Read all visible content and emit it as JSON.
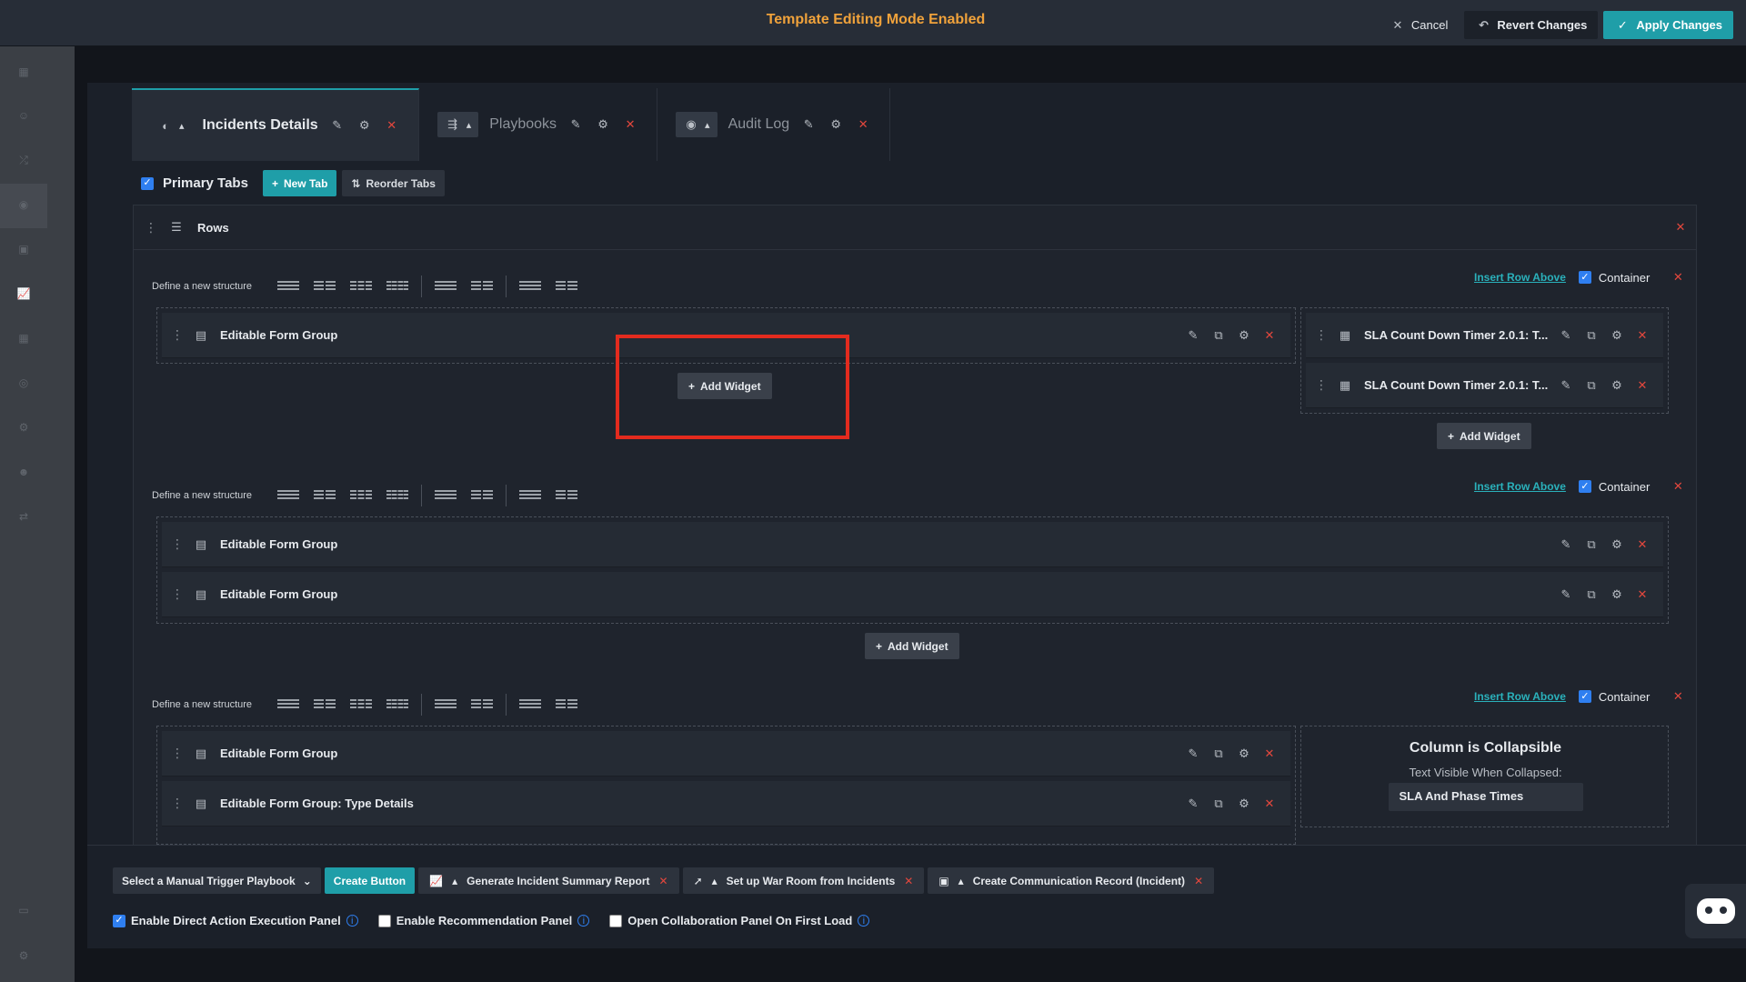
{
  "topbar": {
    "title": "Template Editing Mode Enabled",
    "cancel": "Cancel",
    "revert": "Revert Changes",
    "apply": "Apply Changes"
  },
  "tabs": [
    {
      "label": "Incidents Details",
      "active": true
    },
    {
      "label": "Playbooks",
      "active": false
    },
    {
      "label": "Audit Log",
      "active": false
    }
  ],
  "primary_tabs": {
    "label": "Primary Tabs",
    "checked": true,
    "new_tab": "New Tab",
    "reorder_tabs": "Reorder Tabs"
  },
  "rows_label": "Rows",
  "structure_label": "Define a new structure",
  "insert_row_above": "Insert Row Above",
  "container_label": "Container",
  "add_widget": "Add Widget",
  "rows": [
    {
      "left_widgets": [
        "Editable Form Group"
      ],
      "right_widgets": [
        "SLA Count Down Timer 2.0.1: T...",
        "SLA Count Down Timer 2.0.1: T..."
      ]
    },
    {
      "full_widgets": [
        "Editable Form Group",
        "Editable Form Group"
      ]
    },
    {
      "left_widgets": [
        "Editable Form Group",
        "Editable Form Group: Type Details"
      ],
      "collapsible": {
        "title": "Column is Collapsible",
        "text_label": "Text Visible When Collapsed:",
        "text_value": "SLA And Phase Times"
      }
    }
  ],
  "bottom": {
    "select_playbook": "Select a Manual Trigger Playbook",
    "create_button": "Create Button",
    "chips": [
      "Generate Incident Summary Report",
      "Set up War Room from Incidents",
      "Create Communication Record (Incident)"
    ],
    "options": [
      {
        "label": "Enable Direct Action Execution Panel",
        "checked": true
      },
      {
        "label": "Enable Recommendation Panel",
        "checked": false
      },
      {
        "label": "Open Collaboration Panel On First Load",
        "checked": false
      }
    ]
  },
  "colors": {
    "accent": "#1f9ea8",
    "warning_title": "#f0a23b",
    "delete_red": "#e2473d",
    "highlight_box": "#e32b1e",
    "checkbox_blue": "#2f7ff0"
  }
}
